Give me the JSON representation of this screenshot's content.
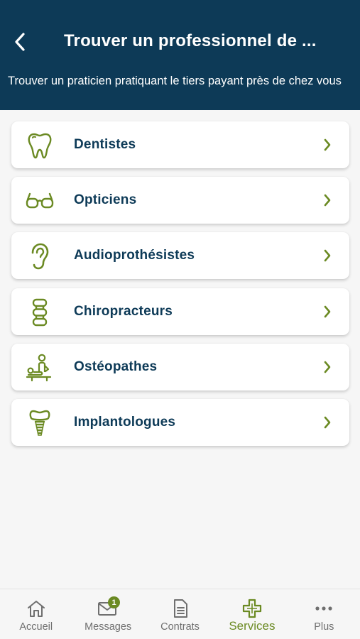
{
  "header": {
    "title": "Trouver un professionnel de ...",
    "subtitle": "Trouver un praticien pratiquant le tiers payant près de chez vous",
    "back_icon": "chevron-left-icon"
  },
  "colors": {
    "header_bg": "#0d3a57",
    "accent": "#6b8a23",
    "label": "#0d3a57",
    "tab_inactive": "#6f6f6f"
  },
  "list": {
    "items": [
      {
        "label": "Dentistes",
        "icon": "tooth-icon"
      },
      {
        "label": "Opticiens",
        "icon": "glasses-icon"
      },
      {
        "label": "Audioprothésistes",
        "icon": "ear-icon"
      },
      {
        "label": "Chiropracteurs",
        "icon": "spine-icon"
      },
      {
        "label": "Ostéopathes",
        "icon": "osteopath-icon"
      },
      {
        "label": "Implantologues",
        "icon": "dental-implant-icon"
      }
    ]
  },
  "tabbar": {
    "tabs": [
      {
        "label": "Accueil",
        "icon": "home-icon",
        "active": false
      },
      {
        "label": "Messages",
        "icon": "mail-icon",
        "active": false,
        "badge": "1"
      },
      {
        "label": "Contrats",
        "icon": "document-icon",
        "active": false
      },
      {
        "label": "Services",
        "icon": "medical-cross-icon",
        "active": true
      },
      {
        "label": "Plus",
        "icon": "more-icon",
        "active": false
      }
    ]
  }
}
